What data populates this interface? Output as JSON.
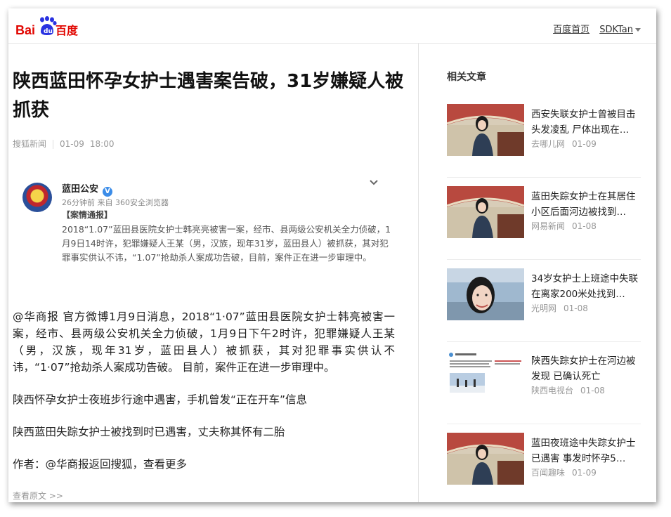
{
  "header": {
    "logo_text": "Baidu百度",
    "home_link": "百度首页",
    "username": "SDKTan"
  },
  "article": {
    "title": "陕西蓝田怀孕女护士遇害案告破，31岁嫌疑人被抓获",
    "source": "搜狐新闻",
    "date": "01-09",
    "time": "18:00",
    "embed": {
      "account": "蓝田公安",
      "sub": "26分钟前 来自 360安全浏览器",
      "label": "【案情通报】",
      "body": "2018“1.07”蓝田县医院女护士韩亮亮被害一案，经市、县两级公安机关全力侦破，1月9日14时许，犯罪嫌疑人王某（男，汉族，现年31岁，蓝田县人）被抓获，其对犯罪事实供认不讳，“1.07”抢劫杀人案成功告破，目前，案件正在进一步审理中。"
    },
    "paragraphs": [
      "@华商报 官方微博1月9日消息，2018“1·07”蓝田县医院女护士韩亮被害一案，经市、县两级公安机关全力侦破，1月9日下午2时许，犯罪嫌疑人王某（男，汉族，现年31岁，蓝田县人）被抓获，其对犯罪事实供认不讳，“1·07”抢劫杀人案成功告破。 目前，案件正在进一步审理中。",
      "陕西怀孕女护士夜班步行途中遇害，手机曾发“正在开车”信息",
      "陕西蓝田失踪女护士被找到时已遇害，丈夫称其怀有二胎",
      "作者：@华商报返回搜狐，查看更多"
    ],
    "view_original": "查看原文 >>"
  },
  "sidebar": {
    "title": "相关文章",
    "items": [
      {
        "title": "西安失联女护士曾被目击头发凌乱 尸体出现在…",
        "source": "去哪儿网",
        "date": "01-09",
        "thumb": "photo-yurt"
      },
      {
        "title": "蓝田失踪女护士在其居住小区后面河边被找到…",
        "source": "网易新闻",
        "date": "01-08",
        "thumb": "photo-yurt"
      },
      {
        "title": "34岁女护士上班途中失联 在离家200米处找到…",
        "source": "光明网",
        "date": "01-08",
        "thumb": "photo-closeup"
      },
      {
        "title": "陕西失踪女护士在河边被发现 已确认死亡",
        "source": "陕西电视台",
        "date": "01-08",
        "thumb": "screenshot-weibo"
      },
      {
        "title": "蓝田夜班途中失踪女护士已遇害 事发时怀孕5…",
        "source": "百闻趣味",
        "date": "01-09",
        "thumb": "photo-yurt"
      }
    ]
  }
}
